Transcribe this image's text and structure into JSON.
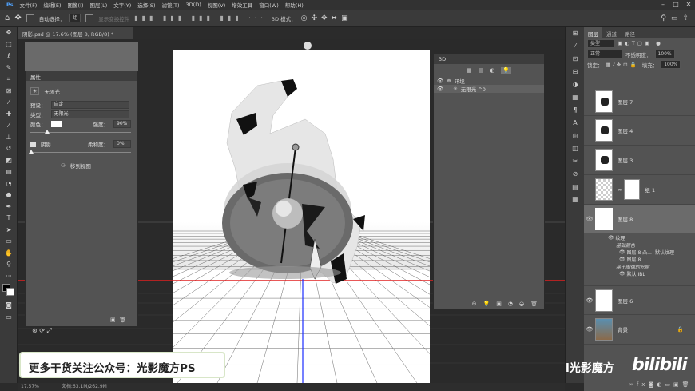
{
  "menu": [
    "文件(F)",
    "编辑(E)",
    "图像(I)",
    "图层(L)",
    "文字(Y)",
    "选择(S)",
    "滤镜(T)",
    "3D(D)",
    "视图(V)",
    "增效工具",
    "窗口(W)",
    "帮助(H)"
  ],
  "options": {
    "auto_select": "自动选择：",
    "auto_select_value": "组",
    "show_transform": "显示变换控件",
    "mode_3d": "3D 模式："
  },
  "document": {
    "tab": "阴影.psd @ 17.6% (图层 8, RGB/8) *",
    "zoom": "17.57%",
    "doc_size": "文档:63.1M/262.9M"
  },
  "properties": {
    "title": "属性",
    "light_label": "无限光",
    "preset_label": "预设：",
    "preset_value": "自定",
    "type_label": "类型：",
    "type_value": "无限光",
    "color_label": "颜色：",
    "intensity_label": "强度：",
    "intensity_value": "90%",
    "shadow_label": "阴影",
    "softness_label": "柔和度：",
    "softness_value": "0%",
    "move_to_view": "移到视图"
  },
  "panel3d": {
    "title": "3D",
    "items": [
      {
        "label": "环境"
      },
      {
        "label": "无限光 ^0"
      }
    ]
  },
  "layers_panel": {
    "tabs": [
      "图层",
      "通道",
      "路径"
    ],
    "kind": "类型",
    "blend": "正常",
    "opacity_label": "不透明度：",
    "opacity_value": "100%",
    "lock_label": "锁定：",
    "fill_label": "填充：",
    "fill_value": "100%",
    "layers": [
      {
        "name": "图层 7"
      },
      {
        "name": "图层 4"
      },
      {
        "name": "图层 3"
      },
      {
        "name": "组 1"
      },
      {
        "name": "图层 8"
      }
    ],
    "sub": [
      "纹理",
      "基础颜色",
      "图层 8 凸...- 默认纹理",
      "图层 8",
      "基于图像的光照",
      "默认 IBL"
    ],
    "bottom_layers": [
      {
        "name": "图层 6"
      },
      {
        "name": "背景"
      }
    ]
  },
  "watermark": {
    "text": "更多干货关注公众号：光影魔方PS",
    "channel": "i光影魔方",
    "site": "bilibili"
  },
  "colors": {
    "bg": "#2b2b2b",
    "panel": "#535353",
    "horizon": "#e02020",
    "axis": "#1a2cff"
  }
}
